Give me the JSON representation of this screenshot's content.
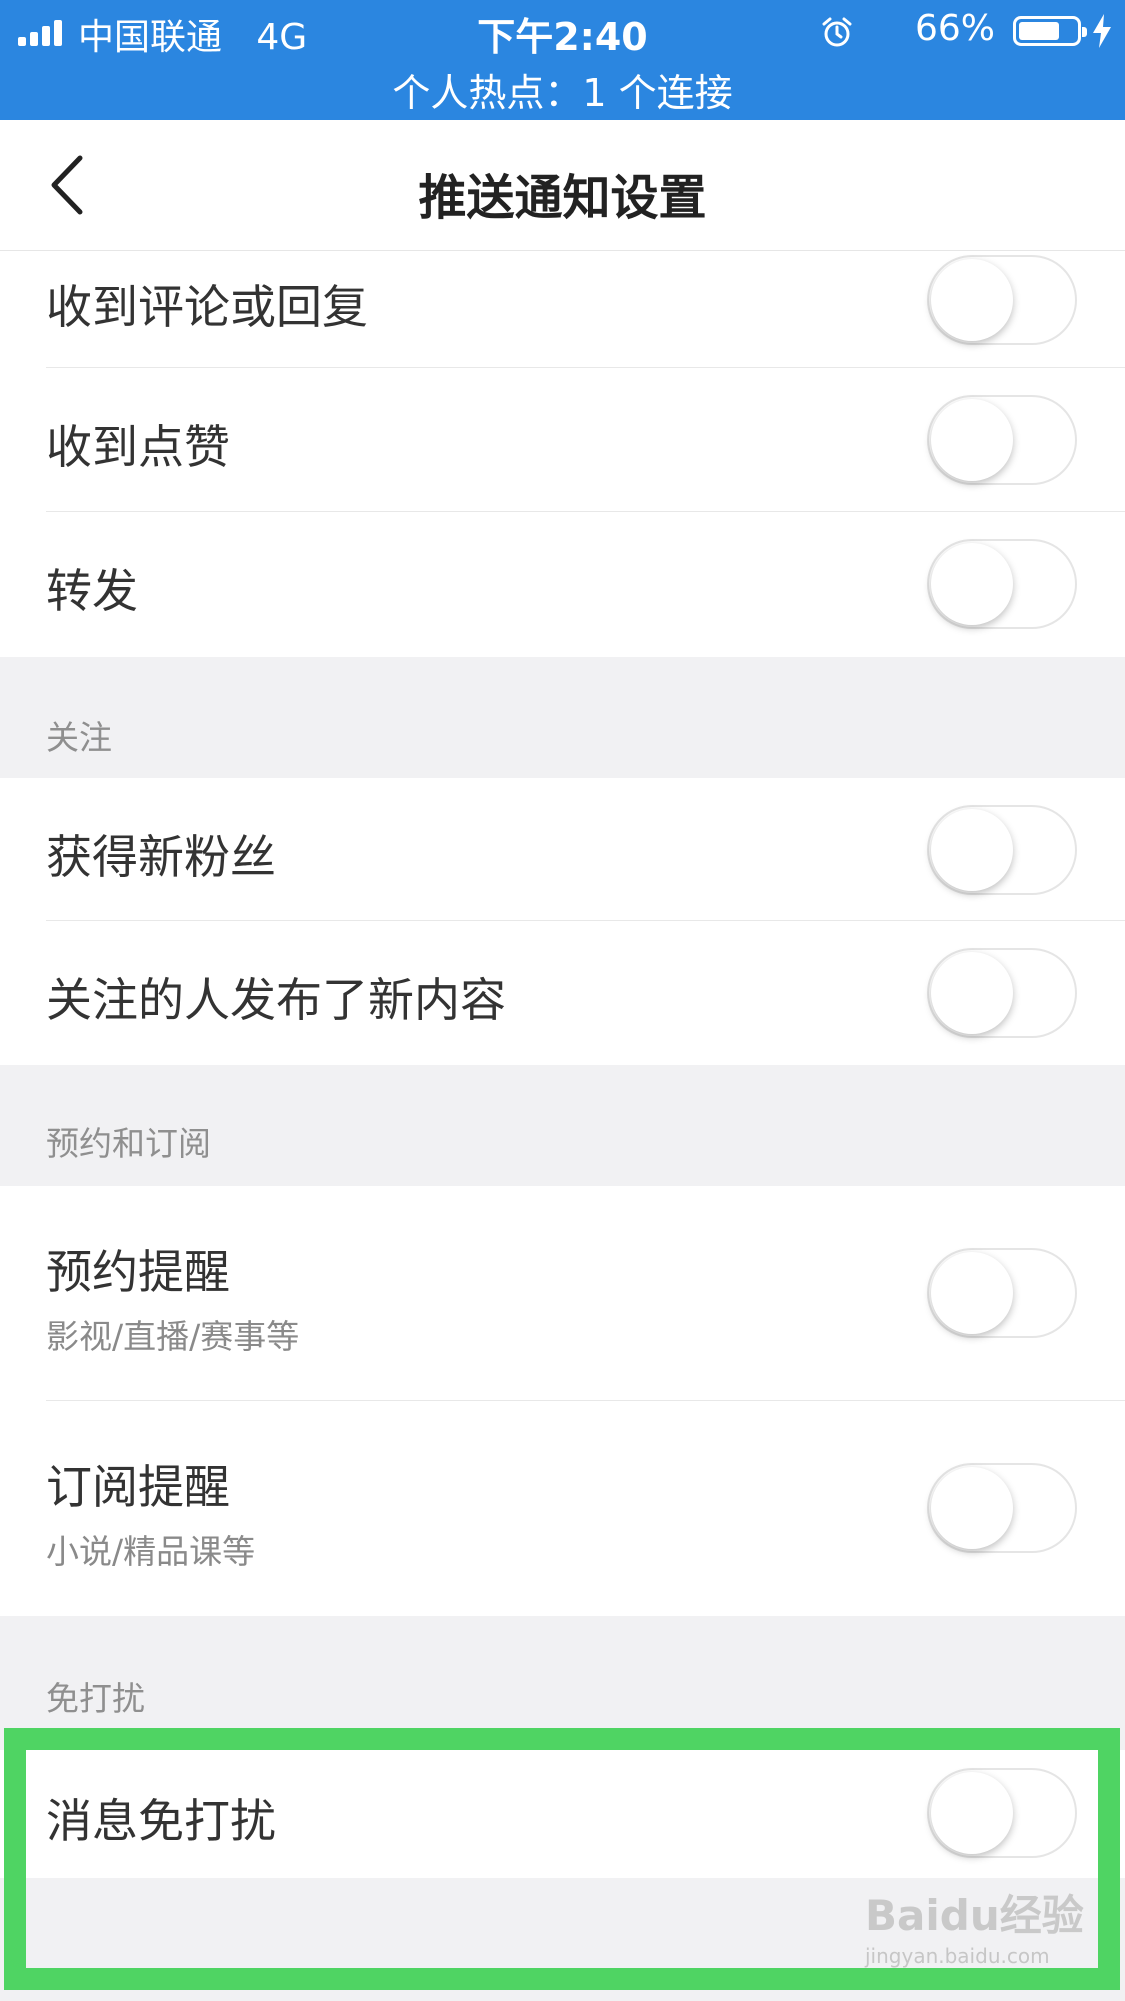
{
  "status_bar": {
    "carrier": "中国联通",
    "network": "4G",
    "time": "下午2:40",
    "battery": "66%",
    "battery_level": 0.66,
    "hotspot": "个人热点：1 个连接",
    "background_color": "#2b86e0"
  },
  "nav": {
    "title": "推送通知设置",
    "back_icon": "chevron-left-icon"
  },
  "rows_group1": [
    {
      "label": "收到评论或回复",
      "on": false
    },
    {
      "label": "收到点赞",
      "on": false
    },
    {
      "label": "转发",
      "on": false
    }
  ],
  "section_follow": {
    "header": "关注",
    "rows": [
      {
        "label": "获得新粉丝",
        "on": false
      },
      {
        "label": "关注的人发布了新内容",
        "on": false
      }
    ]
  },
  "section_subscribe": {
    "header": "预约和订阅",
    "rows": [
      {
        "label": "预约提醒",
        "sub": "影视/直播/赛事等",
        "on": false
      },
      {
        "label": "订阅提醒",
        "sub": "小说/精品课等",
        "on": false
      }
    ]
  },
  "section_dnd": {
    "header": "免打扰",
    "rows": [
      {
        "label": "消息免打扰",
        "on": false
      }
    ]
  },
  "highlight_color": "#4fd463",
  "watermark": {
    "logo": "Baidu经验",
    "url": "jingyan.baidu.com"
  }
}
